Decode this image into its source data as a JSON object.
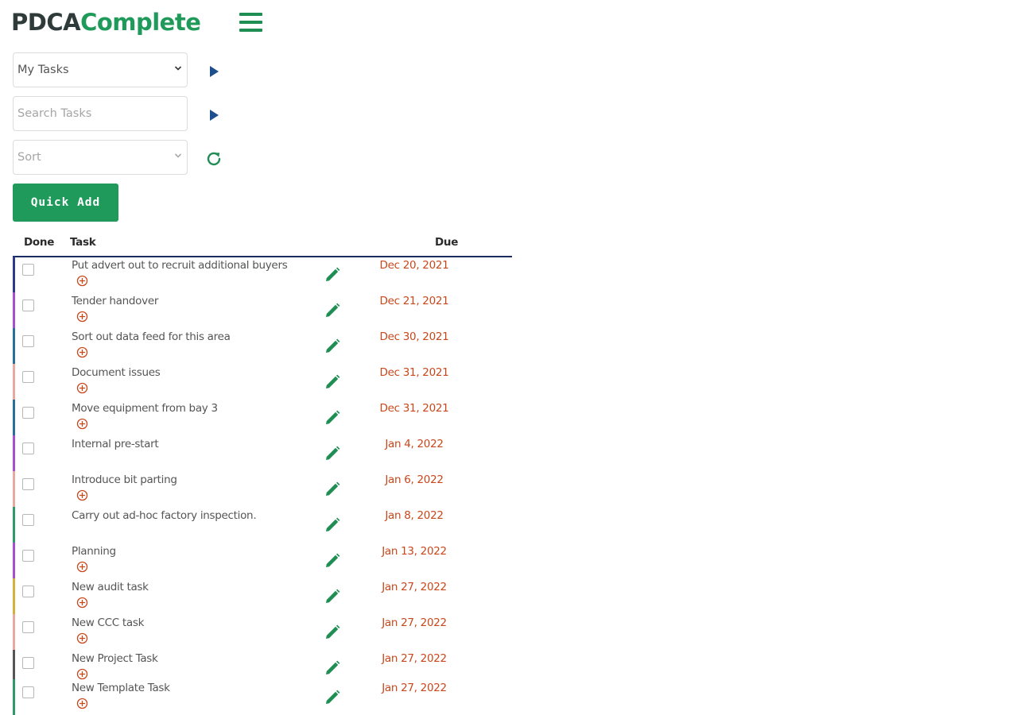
{
  "brand": {
    "part1": "PDCA",
    "part2": "Complete"
  },
  "filters": {
    "view_select": "My Tasks",
    "search_placeholder": "Search Tasks",
    "sort_select": "Sort"
  },
  "quick_add_label": "Quick Add",
  "table": {
    "headers": {
      "done": "Done",
      "task": "Task",
      "due": "Due"
    },
    "rows": [
      {
        "title": "Put advert out to recruit additional buyers",
        "due": "Dec 20, 2021",
        "color": "#2d3a8c",
        "has_plus": true
      },
      {
        "title": "Tender handover",
        "due": "Dec 21, 2021",
        "color": "#a64fd1",
        "has_plus": true
      },
      {
        "title": "Sort out data feed for this area",
        "due": "Dec 30, 2021",
        "color": "#2a6f9a",
        "has_plus": true
      },
      {
        "title": "Document issues",
        "due": "Dec 31, 2021",
        "color": "#e8a9a0",
        "has_plus": true
      },
      {
        "title": "Move equipment from bay 3",
        "due": "Dec 31, 2021",
        "color": "#2a6f9a",
        "has_plus": true
      },
      {
        "title": "Internal pre-start",
        "due": "Jan 4, 2022",
        "color": "#a64fd1",
        "has_plus": false
      },
      {
        "title": "Introduce bit parting",
        "due": "Jan 6, 2022",
        "color": "#e8a9a0",
        "has_plus": true
      },
      {
        "title": "Carry out ad-hoc factory inspection.",
        "due": "Jan 8, 2022",
        "color": "#2e9a6a",
        "has_plus": false
      },
      {
        "title": "Planning",
        "due": "Jan 13, 2022",
        "color": "#a64fd1",
        "has_plus": true
      },
      {
        "title": "New audit task",
        "due": "Jan 27, 2022",
        "color": "#d4b13a",
        "has_plus": true
      },
      {
        "title": "New CCC task",
        "due": "Jan 27, 2022",
        "color": "#e8a9a0",
        "has_plus": true
      },
      {
        "title": "New Project Task",
        "due": "Jan 27, 2022",
        "color": "#555555",
        "has_plus": true
      },
      {
        "title": "New Template Task",
        "due": "Jan 27, 2022",
        "color": "#2e9a6a",
        "has_plus": true
      }
    ]
  },
  "colors": {
    "brand_green": "#1f9a5a",
    "brand_dark": "#2f3b3a",
    "due_red": "#c8471b",
    "play_blue": "#1d4f8f"
  }
}
